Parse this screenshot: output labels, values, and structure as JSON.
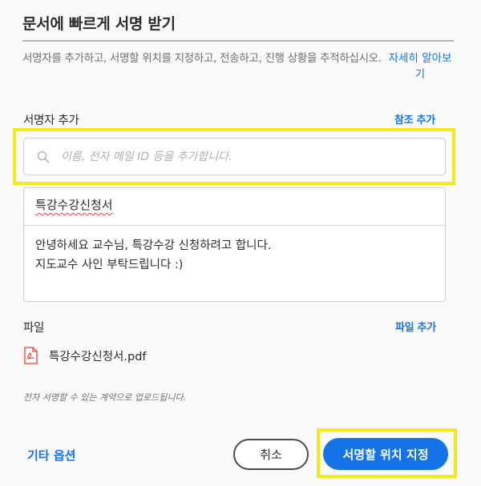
{
  "dialog": {
    "title": "문서에 빠르게 서명 받기",
    "description": "서명자를 추가하고, 서명할 위치를 지정하고, 전송하고, 진행 상황을 추적하십시오.",
    "learn_more": "자세히 알아보기"
  },
  "signers": {
    "label": "서명자 추가",
    "add_reference": "참조 추가",
    "search_placeholder": "이름, 전자 메일 ID 등을 추가합니다.",
    "search_value": ""
  },
  "message": {
    "subject": "특강수강신청서",
    "body_line1": "안녕하세요 교수님, 특강수강 신청하려고 합니다.",
    "body_line2": "지도교수 사인 부탁드립니다 :)"
  },
  "files": {
    "label": "파일",
    "add_file": "파일 추가",
    "items": [
      {
        "name": "특강수강신청서.pdf",
        "icon": "pdf-file-icon"
      }
    ],
    "note": "전자 서명할 수 있는 계약으로 업로드됩니다."
  },
  "footer": {
    "more_options": "기타 옵션",
    "cancel": "취소",
    "submit": "서명할 위치 지정"
  },
  "colors": {
    "accent": "#1473e6",
    "highlight": "#f4ea1a",
    "pdf_red": "#e0443a"
  }
}
